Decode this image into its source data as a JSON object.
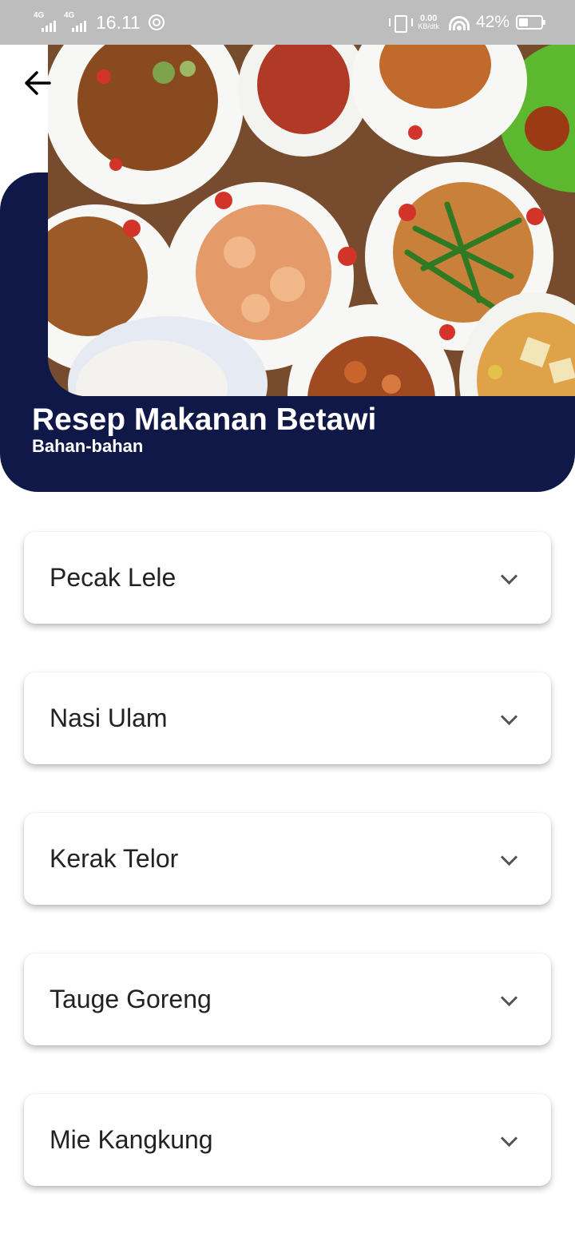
{
  "status_bar": {
    "network_1": "4G",
    "network_2": "4G",
    "time": "16.11",
    "speed_value": "0.00",
    "speed_unit": "KB/dtk",
    "battery": "42%",
    "battery_level": 0.42
  },
  "header": {
    "title": "Resep Makanan Betawi",
    "subtitle": "Bahan-bahan"
  },
  "colors": {
    "header_bg": "#101848",
    "status_bar_bg": "#bdbdbd"
  },
  "recipes": [
    {
      "name": "Pecak Lele"
    },
    {
      "name": "Nasi Ulam"
    },
    {
      "name": "Kerak Telor"
    },
    {
      "name": "Tauge Goreng"
    },
    {
      "name": "Mie Kangkung"
    }
  ]
}
